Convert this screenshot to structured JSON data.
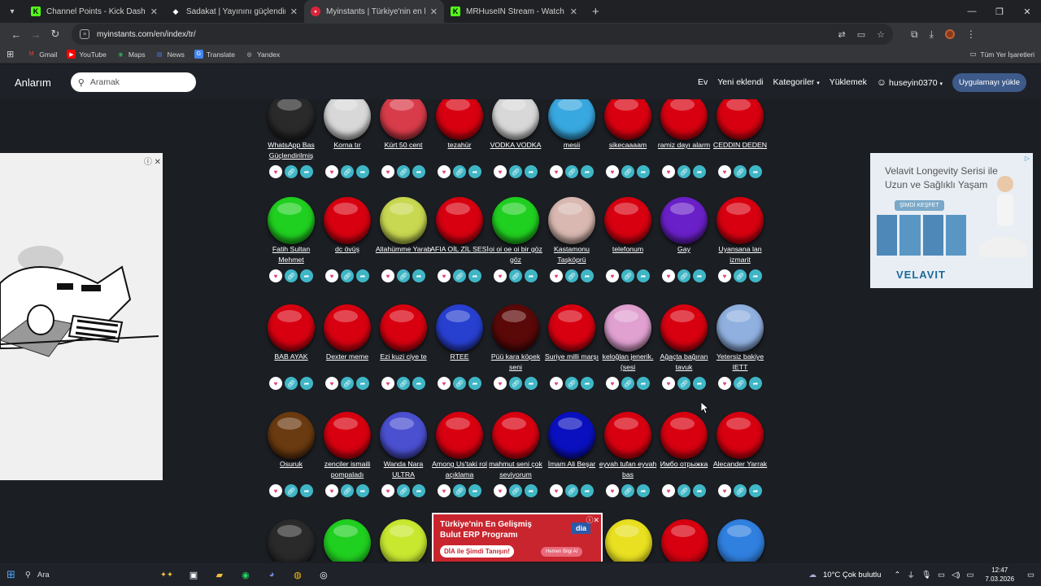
{
  "browser": {
    "tabs": [
      {
        "title": "Channel Points - Kick Dashboard",
        "favicon": "kick-icon",
        "favicon_color": "#53fc18",
        "active": false
      },
      {
        "title": "Sadakat | Yayınını güçlendirmek",
        "favicon": "diamond-icon",
        "favicon_color": "#ffffff",
        "active": false
      },
      {
        "title": "Myinstants | Türkiye'nin en büyük",
        "favicon": "myinstants-icon",
        "favicon_color": "#d9253a",
        "active": true
      },
      {
        "title": "MRHuseIN Stream - Watch Live",
        "favicon": "kick-icon",
        "favicon_color": "#53fc18",
        "active": false
      }
    ],
    "url": "myinstants.com/en/index/tr/",
    "bookmarks": [
      "Gmail",
      "YouTube",
      "Maps",
      "News",
      "Translate",
      "Yandex"
    ],
    "bookmarks_all": "Tüm Yer İşaretleri"
  },
  "site": {
    "brand": "Anlarım",
    "search_placeholder": "Aramak",
    "menu": {
      "home": "Ev",
      "new": "Yeni eklendi",
      "categories": "Kategoriler",
      "upload": "Yüklemek",
      "user": "huseyin0370",
      "install": "Uygulamayı yükle"
    }
  },
  "instants": [
    [
      {
        "label": "WhatsApp Bas Güçlendirilmiş",
        "color": "#2a2a2a"
      },
      {
        "label": "Korna tır",
        "color": "#d8d8d8"
      },
      {
        "label": "Kürt 50 cent",
        "color": "#d83c4a"
      },
      {
        "label": "tezahür",
        "color": "#d80010"
      },
      {
        "label": "VODKA VODKA",
        "color": "#d8d8d8"
      },
      {
        "label": "mesii",
        "color": "#38a8e0"
      },
      {
        "label": "sikecaaaam",
        "color": "#d80010"
      },
      {
        "label": "ramiz dayı alarm",
        "color": "#d80010"
      },
      {
        "label": "CEDDIN DEDEN",
        "color": "#d80010"
      }
    ],
    [
      {
        "label": "Fatih Sultan Mehmet",
        "color": "#20d020"
      },
      {
        "label": "dc övüş",
        "color": "#d80010"
      },
      {
        "label": "Allahümme Yarab",
        "color": "#c8d850"
      },
      {
        "label": "AFIA OİL ZİL SESİ",
        "color": "#d80010"
      },
      {
        "label": "oi oi oe oi bir göz göz",
        "color": "#20d020"
      },
      {
        "label": "Kastamonu Taşköprü",
        "color": "#d8b8b0"
      },
      {
        "label": "telefonum",
        "color": "#d80010"
      },
      {
        "label": "Gay",
        "color": "#6a20c8"
      },
      {
        "label": "Uyansana lan izmarit",
        "color": "#d80010"
      }
    ],
    [
      {
        "label": "BAB AYAK",
        "color": "#d80010"
      },
      {
        "label": "Dexter meme",
        "color": "#d80010"
      },
      {
        "label": "Ezi kuzi ciye te",
        "color": "#d80010"
      },
      {
        "label": "RTEE",
        "color": "#2840d0"
      },
      {
        "label": "Püü kara köpek seni",
        "color": "#5a0808"
      },
      {
        "label": "Suriye milli marşı",
        "color": "#d80010"
      },
      {
        "label": "keloğlan jenerik. (sesi",
        "color": "#e0a0d0"
      },
      {
        "label": "Ağaçta bağıran tavuk",
        "color": "#d80010"
      },
      {
        "label": "Yetersiz bakiye IETT",
        "color": "#90b0e0"
      }
    ],
    [
      {
        "label": "Osuruk",
        "color": "#6a3a10"
      },
      {
        "label": "zenciler ismaili pompaladı",
        "color": "#d80010"
      },
      {
        "label": "Wanda Nara ULTRA",
        "color": "#4a50d0"
      },
      {
        "label": "Among Us'taki rol açıklama",
        "color": "#d80010"
      },
      {
        "label": "mahmut seni çok seviyorum",
        "color": "#d80010"
      },
      {
        "label": "İmam Ali Beşar",
        "color": "#0a10c0"
      },
      {
        "label": "eyvah tufan eyvah bas",
        "color": "#d80010"
      },
      {
        "label": "Имбо отрыжка",
        "color": "#d80010"
      },
      {
        "label": "Alecander Yarrak",
        "color": "#d80010"
      }
    ]
  ],
  "bottom_row_colors": [
    "#2a2a2a",
    "#20d020",
    "#c8e830",
    "#e8e020",
    "#d80010",
    "#3080e0"
  ],
  "ads": {
    "right_line1": "Velavit Longevity Serisi ile",
    "right_line2": "Uzun ve Sağlıklı Yaşam",
    "right_cta": "ŞİMDİ KEŞFET",
    "right_brand": "VELAVIT",
    "bottom_line1": "Türkiye'nin En Gelişmiş",
    "bottom_line2": "Bulut ERP Programı",
    "bottom_cta": "DİA ile Şimdi Tanışın!",
    "bottom_btn": "Hemen Bilgi Al",
    "bottom_brand": "dia"
  },
  "taskbar": {
    "search": "Ara",
    "weather": "10°C  Çok bulutlu",
    "time": "12:47",
    "date": "7.03.2026"
  }
}
